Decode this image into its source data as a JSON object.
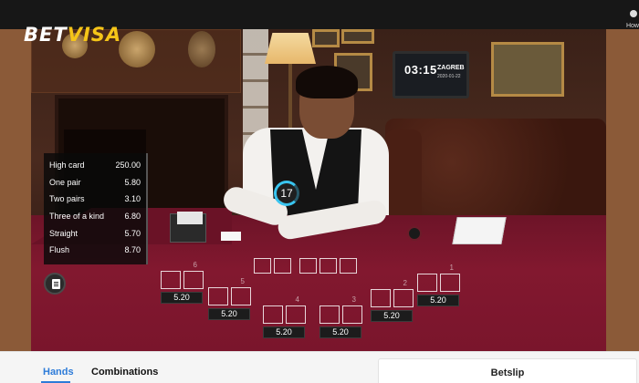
{
  "logo": {
    "part1": "BET",
    "part2": "VISA"
  },
  "help_label": "How",
  "clock": {
    "time": "03:15",
    "city": "ZAGREB",
    "date": "2020-01-22"
  },
  "timer": "17",
  "payouts": [
    {
      "hand": "High card",
      "odds": "250.00"
    },
    {
      "hand": "One pair",
      "odds": "5.80"
    },
    {
      "hand": "Two pairs",
      "odds": "3.10"
    },
    {
      "hand": "Three of a kind",
      "odds": "6.80"
    },
    {
      "hand": "Straight",
      "odds": "5.70"
    },
    {
      "hand": "Flush",
      "odds": "8.70"
    }
  ],
  "spots": [
    {
      "number": "6",
      "odds": "5.20"
    },
    {
      "number": "5",
      "odds": "5.20"
    },
    {
      "number": "4",
      "odds": "5.20"
    },
    {
      "number": "3",
      "odds": "5.20"
    },
    {
      "number": "2",
      "odds": "5.20"
    },
    {
      "number": "1",
      "odds": "5.20"
    }
  ],
  "tabs": {
    "hands": "Hands",
    "combinations": "Combinations"
  },
  "betslip": {
    "title": "Betslip"
  }
}
